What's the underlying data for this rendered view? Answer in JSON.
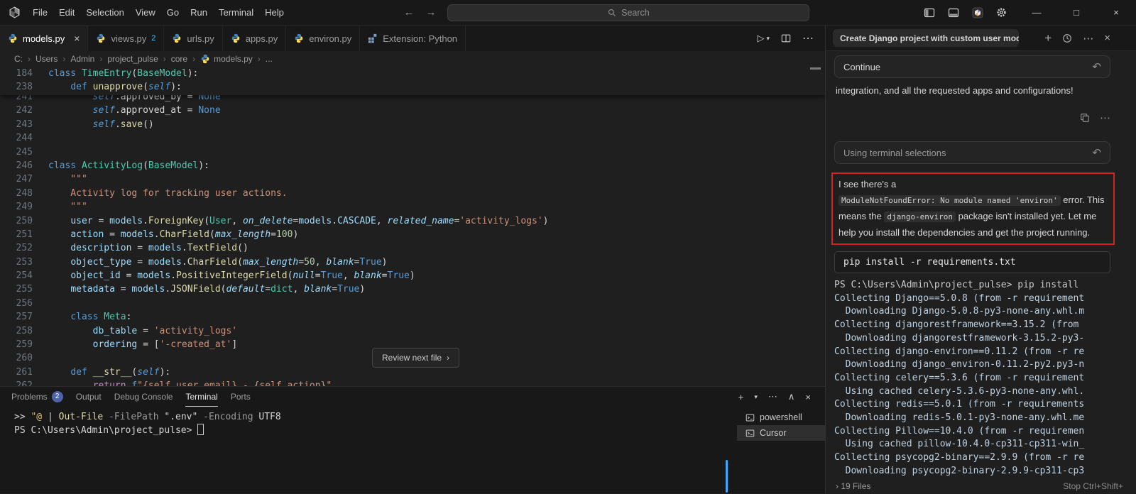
{
  "titlebar": {
    "menus": [
      "File",
      "Edit",
      "Selection",
      "View",
      "Go",
      "Run",
      "Terminal",
      "Help"
    ],
    "search": "Search",
    "window_controls": {
      "minimize": "—",
      "maximize": "□",
      "close": "×"
    }
  },
  "editor_tabs": [
    {
      "label": "models.py",
      "active": true,
      "close": "×"
    },
    {
      "label": "views.py",
      "badge": "2"
    },
    {
      "label": "urls.py"
    },
    {
      "label": "apps.py"
    },
    {
      "label": "environ.py"
    },
    {
      "label": "Extension: Python",
      "kind": "extension"
    }
  ],
  "breadcrumb": [
    "C:",
    "Users",
    "Admin",
    "project_pulse",
    "core",
    "models.py",
    "..."
  ],
  "editor": {
    "sticky_lines": [
      {
        "n": 184,
        "t": [
          [
            "class ",
            "kw"
          ],
          [
            "TimeEntry",
            "cls"
          ],
          [
            "(",
            "pl"
          ],
          [
            "BaseModel",
            "cls"
          ],
          [
            "):",
            "pl"
          ]
        ]
      },
      {
        "n": 238,
        "t": [
          [
            "    ",
            "pl"
          ],
          [
            "def ",
            "kw"
          ],
          [
            "unapprove",
            "fn"
          ],
          [
            "(",
            "pl"
          ],
          [
            "self",
            "self"
          ],
          [
            "):",
            "pl"
          ]
        ]
      }
    ],
    "lines": [
      {
        "n": 241,
        "t": [
          [
            "        ",
            "pl"
          ],
          [
            "self",
            "self"
          ],
          [
            ".approved_by = ",
            "pl"
          ],
          [
            "None",
            "kw"
          ]
        ]
      },
      {
        "n": 242,
        "t": [
          [
            "        ",
            "pl"
          ],
          [
            "self",
            "self"
          ],
          [
            ".approved_at = ",
            "pl"
          ],
          [
            "None",
            "kw"
          ]
        ]
      },
      {
        "n": 243,
        "t": [
          [
            "        ",
            "pl"
          ],
          [
            "self",
            "self"
          ],
          [
            ".",
            "pl"
          ],
          [
            "save",
            "fn"
          ],
          [
            "()",
            "pl"
          ]
        ]
      },
      {
        "n": 244,
        "t": []
      },
      {
        "n": 245,
        "t": []
      },
      {
        "n": 246,
        "t": [
          [
            "class ",
            "kw"
          ],
          [
            "ActivityLog",
            "cls"
          ],
          [
            "(",
            "pl"
          ],
          [
            "BaseModel",
            "cls"
          ],
          [
            "):",
            "pl"
          ]
        ]
      },
      {
        "n": 247,
        "t": [
          [
            "    \"\"\"",
            "str"
          ]
        ]
      },
      {
        "n": 248,
        "t": [
          [
            "    Activity log for tracking user actions.",
            "str"
          ]
        ]
      },
      {
        "n": 249,
        "t": [
          [
            "    \"\"\"",
            "str"
          ]
        ]
      },
      {
        "n": 250,
        "t": [
          [
            "    ",
            "pl"
          ],
          [
            "user",
            "prop"
          ],
          [
            " = ",
            "pl"
          ],
          [
            "models",
            "prop"
          ],
          [
            ".",
            "pl"
          ],
          [
            "ForeignKey",
            "fn"
          ],
          [
            "(",
            "pl"
          ],
          [
            "User",
            "cls"
          ],
          [
            ", ",
            "pl"
          ],
          [
            "on_delete",
            "param"
          ],
          [
            "=",
            "pl"
          ],
          [
            "models",
            "prop"
          ],
          [
            ".",
            "pl"
          ],
          [
            "CASCADE",
            "prop"
          ],
          [
            ", ",
            "pl"
          ],
          [
            "related_name",
            "param"
          ],
          [
            "=",
            "pl"
          ],
          [
            "'activity_logs'",
            "str"
          ],
          [
            ")",
            "pl"
          ]
        ]
      },
      {
        "n": 251,
        "t": [
          [
            "    ",
            "pl"
          ],
          [
            "action",
            "prop"
          ],
          [
            " = ",
            "pl"
          ],
          [
            "models",
            "prop"
          ],
          [
            ".",
            "pl"
          ],
          [
            "CharField",
            "fn"
          ],
          [
            "(",
            "pl"
          ],
          [
            "max_length",
            "param"
          ],
          [
            "=",
            "pl"
          ],
          [
            "100",
            "num"
          ],
          [
            ")",
            "pl"
          ]
        ]
      },
      {
        "n": 252,
        "t": [
          [
            "    ",
            "pl"
          ],
          [
            "description",
            "prop"
          ],
          [
            " = ",
            "pl"
          ],
          [
            "models",
            "prop"
          ],
          [
            ".",
            "pl"
          ],
          [
            "TextField",
            "fn"
          ],
          [
            "()",
            "pl"
          ]
        ]
      },
      {
        "n": 253,
        "t": [
          [
            "    ",
            "pl"
          ],
          [
            "object_type",
            "prop"
          ],
          [
            " = ",
            "pl"
          ],
          [
            "models",
            "prop"
          ],
          [
            ".",
            "pl"
          ],
          [
            "CharField",
            "fn"
          ],
          [
            "(",
            "pl"
          ],
          [
            "max_length",
            "param"
          ],
          [
            "=",
            "pl"
          ],
          [
            "50",
            "num"
          ],
          [
            ", ",
            "pl"
          ],
          [
            "blank",
            "param"
          ],
          [
            "=",
            "pl"
          ],
          [
            "True",
            "kw"
          ],
          [
            ")",
            "pl"
          ]
        ]
      },
      {
        "n": 254,
        "t": [
          [
            "    ",
            "pl"
          ],
          [
            "object_id",
            "prop"
          ],
          [
            " = ",
            "pl"
          ],
          [
            "models",
            "prop"
          ],
          [
            ".",
            "pl"
          ],
          [
            "PositiveIntegerField",
            "fn"
          ],
          [
            "(",
            "pl"
          ],
          [
            "null",
            "param"
          ],
          [
            "=",
            "pl"
          ],
          [
            "True",
            "kw"
          ],
          [
            ", ",
            "pl"
          ],
          [
            "blank",
            "param"
          ],
          [
            "=",
            "pl"
          ],
          [
            "True",
            "kw"
          ],
          [
            ")",
            "pl"
          ]
        ]
      },
      {
        "n": 255,
        "t": [
          [
            "    ",
            "pl"
          ],
          [
            "metadata",
            "prop"
          ],
          [
            " = ",
            "pl"
          ],
          [
            "models",
            "prop"
          ],
          [
            ".",
            "pl"
          ],
          [
            "JSONField",
            "fn"
          ],
          [
            "(",
            "pl"
          ],
          [
            "default",
            "param"
          ],
          [
            "=",
            "pl"
          ],
          [
            "dict",
            "cls"
          ],
          [
            ", ",
            "pl"
          ],
          [
            "blank",
            "param"
          ],
          [
            "=",
            "pl"
          ],
          [
            "True",
            "kw"
          ],
          [
            ")",
            "pl"
          ]
        ]
      },
      {
        "n": 256,
        "t": []
      },
      {
        "n": 257,
        "t": [
          [
            "    ",
            "pl"
          ],
          [
            "class ",
            "kw"
          ],
          [
            "Meta",
            "cls"
          ],
          [
            ":",
            "pl"
          ]
        ]
      },
      {
        "n": 258,
        "t": [
          [
            "        ",
            "pl"
          ],
          [
            "db_table",
            "prop"
          ],
          [
            " = ",
            "pl"
          ],
          [
            "'activity_logs'",
            "str"
          ]
        ]
      },
      {
        "n": 259,
        "t": [
          [
            "        ",
            "pl"
          ],
          [
            "ordering",
            "prop"
          ],
          [
            " = [",
            "pl"
          ],
          [
            "'-created_at'",
            "str"
          ],
          [
            "]",
            "pl"
          ]
        ]
      },
      {
        "n": 260,
        "t": []
      },
      {
        "n": 261,
        "t": [
          [
            "    ",
            "pl"
          ],
          [
            "def ",
            "kw"
          ],
          [
            "__str__",
            "fn"
          ],
          [
            "(",
            "pl"
          ],
          [
            "self",
            "self"
          ],
          [
            "):",
            "pl"
          ]
        ]
      },
      {
        "n": 262,
        "t": [
          [
            "        ",
            "pl"
          ],
          [
            "return ",
            "ctrl"
          ],
          [
            "f",
            "kw"
          ],
          [
            "\"{self.user.email} - {self.action}\"",
            "str"
          ]
        ]
      }
    ],
    "review_button": "Review next file",
    "review_chevron": "›"
  },
  "panel": {
    "tabs": [
      {
        "label": "Problems",
        "badge": "2"
      },
      {
        "label": "Output"
      },
      {
        "label": "Debug Console"
      },
      {
        "label": "Terminal",
        "active": true
      },
      {
        "label": "Ports"
      }
    ],
    "actions": [
      "+",
      "▾",
      "⋯",
      "∧",
      "×"
    ],
    "terminal_lines": [
      {
        "t": [
          [
            ">> ",
            "pl"
          ],
          [
            "\"@",
            "ystr"
          ],
          [
            " | ",
            "pl"
          ],
          [
            "Out-File",
            "fn"
          ],
          [
            " -FilePath ",
            "gray"
          ],
          [
            "\".env\"",
            "pl"
          ],
          [
            " -Encoding ",
            "gray"
          ],
          [
            "UTF8",
            "pl"
          ]
        ]
      },
      {
        "t": [
          [
            "PS C:\\Users\\Admin\\project_pulse> ",
            "pl"
          ]
        ],
        "cursor": true
      }
    ],
    "terminal_list": [
      {
        "label": "powershell"
      },
      {
        "label": "Cursor",
        "selected": true
      }
    ]
  },
  "chat": {
    "title": "Create Django project with custom user mod",
    "continue_label": "Continue",
    "message_tail": "integration, and all the requested apps and configurations!",
    "selection_label": "Using terminal selections",
    "message": [
      {
        "t": "text",
        "v": "I see there's a "
      },
      {
        "t": "code",
        "v": "ModuleNotFoundError: No module named 'environ'"
      },
      {
        "t": "text",
        "v": " error. This means the "
      },
      {
        "t": "code",
        "v": "django-environ"
      },
      {
        "t": "text",
        "v": " package isn't installed yet. Let me help you install the dependencies and get the project running."
      }
    ],
    "command": "pip install -r requirements.txt",
    "output": [
      "PS C:\\Users\\Admin\\project_pulse> pip install",
      "Collecting Django==5.0.8 (from -r requirement",
      "  Downloading Django-5.0.8-py3-none-any.whl.m",
      "Collecting djangorestframework==3.15.2 (from",
      "  Downloading djangorestframework-3.15.2-py3-",
      "Collecting django-environ==0.11.2 (from -r re",
      "  Downloading django_environ-0.11.2-py2.py3-n",
      "Collecting celery==5.3.6 (from -r requirement",
      "  Using cached celery-5.3.6-py3-none-any.whl.",
      "Collecting redis==5.0.1 (from -r requirements",
      "  Downloading redis-5.0.1-py3-none-any.whl.me",
      "Collecting Pillow==10.4.0 (from -r requiremen",
      "  Using cached pillow-10.4.0-cp311-cp311-win_",
      "Collecting psycopg2-binary==2.9.9 (from -r re",
      "  Downloading psycopg2-binary-2.9.9-cp311-cp3"
    ],
    "files_chevron": "›",
    "files_summary": "19 Files",
    "stop_label": "Stop",
    "stop_shortcut": "Ctrl+Shift+"
  },
  "colors": {
    "annotation_red": "#d42222",
    "badge_blue": "#4e63a9",
    "terminal_scrollbar_blue": "#3ea7ff",
    "tab_badge_blue": "#4fc1ff"
  }
}
